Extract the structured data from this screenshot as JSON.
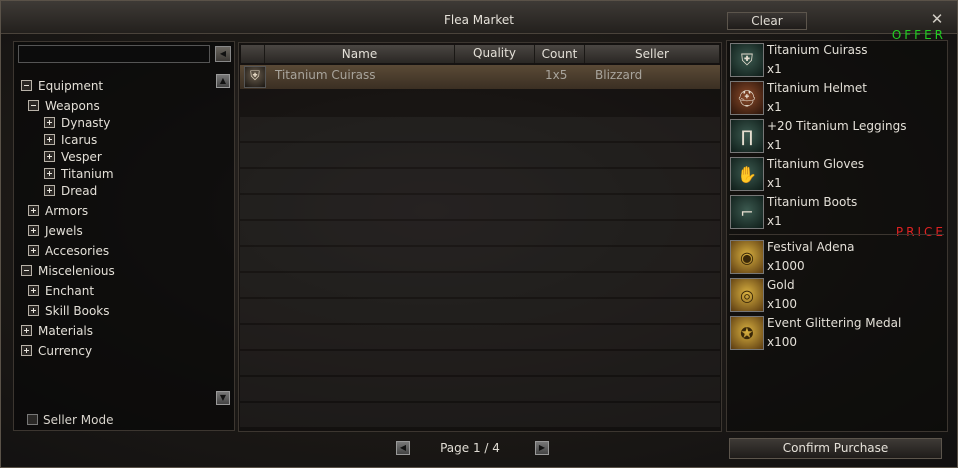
{
  "window": {
    "title": "Flea Market",
    "clear_label": "Clear",
    "close_glyph": "✕"
  },
  "search": {
    "value": "",
    "placeholder": ""
  },
  "tree": [
    {
      "label": "Equipment",
      "state": "minus"
    },
    {
      "label": "Weapons",
      "state": "minus"
    },
    {
      "label": "Dynasty",
      "state": "plus"
    },
    {
      "label": "Icarus",
      "state": "plus"
    },
    {
      "label": "Vesper",
      "state": "plus"
    },
    {
      "label": "Titanium",
      "state": "plus"
    },
    {
      "label": "Dread",
      "state": "plus"
    },
    {
      "label": "Armors",
      "state": "plus"
    },
    {
      "label": "Jewels",
      "state": "plus"
    },
    {
      "label": "Accesories",
      "state": "plus"
    },
    {
      "label": "Miscelenious",
      "state": "minus"
    },
    {
      "label": "Enchant",
      "state": "plus"
    },
    {
      "label": "Skill Books",
      "state": "plus"
    },
    {
      "label": "Materials",
      "state": "plus"
    },
    {
      "label": "Currency",
      "state": "plus"
    }
  ],
  "seller_mode_label": "Seller Mode",
  "table": {
    "columns": [
      "Name",
      "Quality",
      "Count",
      "Seller"
    ],
    "rows": [
      {
        "name": "Titanium Cuirass",
        "quality": "",
        "count": "1x5",
        "seller": "Blizzard",
        "icon": "armor-icon"
      }
    ]
  },
  "pager": {
    "text": "Page 1 / 4"
  },
  "offer": {
    "label": "OFFER",
    "color": "#22cc22",
    "items": [
      {
        "name": "Titanium Cuirass",
        "count": "x1",
        "icon": "cuirass-icon"
      },
      {
        "name": "Titanium Helmet",
        "count": "x1",
        "icon": "helmet-icon"
      },
      {
        "name": "+20 Titanium Leggings",
        "count": "x1",
        "icon": "leggings-icon"
      },
      {
        "name": "Titanium Gloves",
        "count": "x1",
        "icon": "gloves-icon"
      },
      {
        "name": "Titanium Boots",
        "count": "x1",
        "icon": "boots-icon"
      }
    ]
  },
  "price": {
    "label": "PRICE",
    "color": "#dd2222",
    "items": [
      {
        "name": "Festival Adena",
        "count": "x1000",
        "icon": "adena-coin-icon"
      },
      {
        "name": "Gold",
        "count": "x100",
        "icon": "gold-coin-icon"
      },
      {
        "name": "Event Glittering Medal",
        "count": "x100",
        "icon": "medal-icon"
      }
    ]
  },
  "confirm_label": "Confirm Purchase"
}
